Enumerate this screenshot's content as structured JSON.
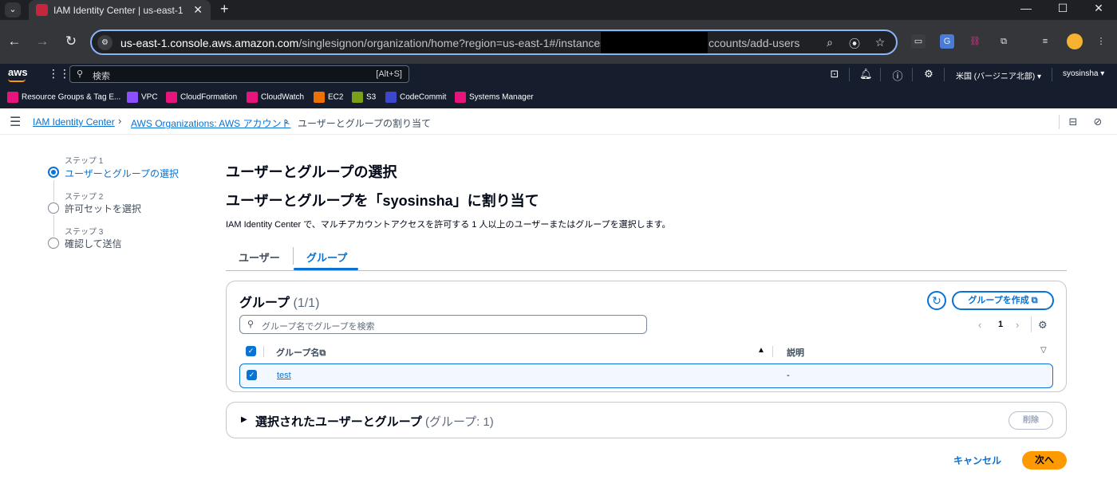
{
  "browser": {
    "tab_title": "IAM Identity Center | us-east-1",
    "tab_menu": "⌄",
    "tab_close": "✕",
    "new_tab": "+",
    "window": {
      "minimize": "—",
      "maximize": "☐",
      "close": "✕"
    },
    "url_host": "us-east-1.console.aws.amazon.com",
    "url_path": "/singlesignon/organization/home?region=us-east-1#/instances/",
    "url_tail": "ccounts/add-users"
  },
  "aws_nav": {
    "logo": "aws",
    "search_placeholder": "検索",
    "search_shortcut": "[Alt+S]",
    "region": "米国 (バージニア北部) ▾",
    "user": "syosinsha ▾"
  },
  "favorites": [
    {
      "label": "Resource Groups & Tag E...",
      "color": "#e7157b"
    },
    {
      "label": "VPC",
      "color": "#8c4fff"
    },
    {
      "label": "CloudFormation",
      "color": "#e7157b"
    },
    {
      "label": "CloudWatch",
      "color": "#e7157b"
    },
    {
      "label": "EC2",
      "color": "#ed7100"
    },
    {
      "label": "S3",
      "color": "#7aa116"
    },
    {
      "label": "CodeCommit",
      "color": "#3b48cc"
    },
    {
      "label": "Systems Manager",
      "color": "#e7157b"
    }
  ],
  "breadcrumb": {
    "items": [
      "IAM Identity Center",
      "AWS Organizations: AWS アカウント",
      "ユーザーとグループの割り当て"
    ],
    "separator": "›"
  },
  "wizard": {
    "steps": [
      {
        "small": "ステップ 1",
        "title": "ユーザーとグループの選択"
      },
      {
        "small": "ステップ 2",
        "title": "許可セットを選択"
      },
      {
        "small": "ステップ 3",
        "title": "確認して送信"
      }
    ]
  },
  "main": {
    "title": "ユーザーとグループの選択",
    "subtitle": "ユーザーとグループを「syosinsha」に割り当て",
    "description": "IAM Identity Center で、マルチアカウントアクセスを許可する 1 人以上のユーザーまたはグループを選択します。",
    "tabs": [
      {
        "label": "ユーザー"
      },
      {
        "label": "グループ"
      }
    ]
  },
  "groups_table": {
    "title": "グループ",
    "count": "(1/1)",
    "create_button": "グループを作成",
    "search_placeholder": "グループ名でグループを検索",
    "page": "1",
    "columns": [
      "グループ名",
      "説明"
    ],
    "rows": [
      {
        "name": "test",
        "description": "-"
      }
    ]
  },
  "selected_section": {
    "title": "選択されたユーザーとグループ",
    "count": "(グループ: 1)",
    "remove_button": "削除"
  },
  "actions": {
    "cancel": "キャンセル",
    "next": "次へ"
  },
  "colors": {
    "accent": "#0972d3",
    "primary_button": "#ff9900",
    "aws_nav_bg": "#161e2d"
  }
}
